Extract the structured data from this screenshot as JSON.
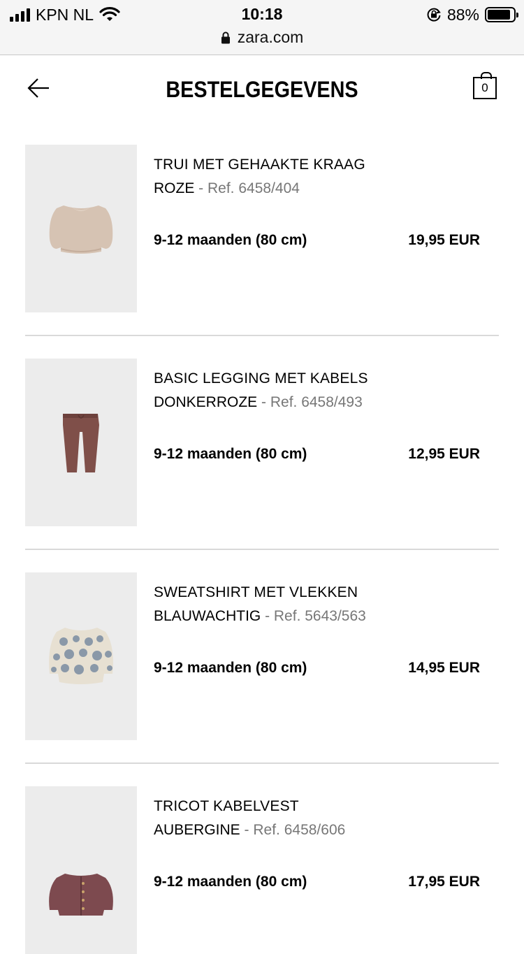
{
  "status_bar": {
    "carrier": "KPN NL",
    "time": "10:18",
    "battery": "88%",
    "battery_level": 0.88
  },
  "browser": {
    "url": "zara.com"
  },
  "header": {
    "title": "BESTELGEGEVENS",
    "cart_count": "0"
  },
  "items": [
    {
      "name": "TRUI MET GEHAAKTE KRAAG",
      "color": "ROZE",
      "ref": " - Ref. 6458/404",
      "size": "9-12 maanden (80 cm)",
      "price": "19,95 EUR"
    },
    {
      "name": "BASIC LEGGING MET KABELS",
      "color": "DONKERROZE",
      "ref": " - Ref. 6458/493",
      "size": "9-12 maanden (80 cm)",
      "price": "12,95 EUR"
    },
    {
      "name": "SWEATSHIRT MET VLEKKEN",
      "color": "BLAUWACHTIG",
      "ref": " - Ref. 5643/563",
      "size": "9-12 maanden (80 cm)",
      "price": "14,95 EUR"
    },
    {
      "name": "TRICOT KABELVEST",
      "color": "AUBERGINE",
      "ref": " - Ref. 6458/606",
      "size": "9-12 maanden (80 cm)",
      "price": "17,95 EUR"
    }
  ]
}
